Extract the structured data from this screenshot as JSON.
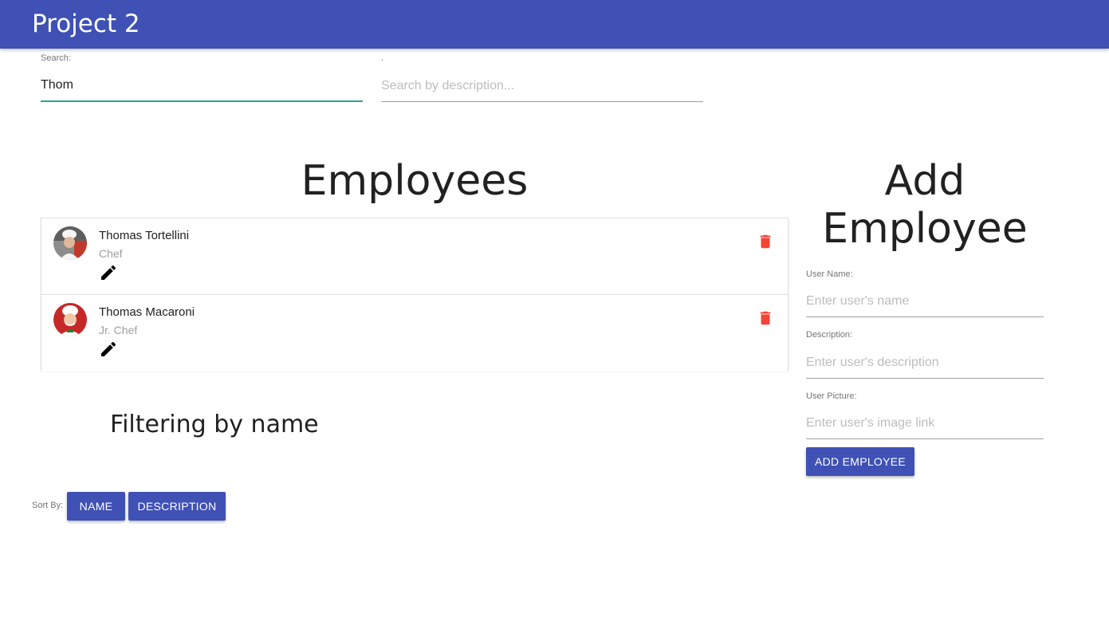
{
  "app": {
    "title": "Project 2",
    "accent_color": "#3f51b5",
    "focus_color": "#26a69a"
  },
  "search": {
    "name_label": "Search:",
    "name_value": "Thom",
    "desc_label": ".",
    "desc_placeholder": "Search by description..."
  },
  "employees": {
    "heading": "Employees",
    "items": [
      {
        "name": "Thomas Tortellini",
        "description": "Chef",
        "avatar": "chef-avatar",
        "edit_icon": "pencil-icon",
        "delete_icon": "trash-icon"
      },
      {
        "name": "Thomas Macaroni",
        "description": "Jr. Chef",
        "avatar": "chef-avatar",
        "edit_icon": "pencil-icon",
        "delete_icon": "trash-icon"
      }
    ]
  },
  "caption": "Filtering by name",
  "sort": {
    "label": "Sort By:",
    "name_button": "NAME",
    "description_button": "DESCRIPTION"
  },
  "add_employee": {
    "heading_line1": "Add",
    "heading_line2": "Employee",
    "user_name_label": "User Name:",
    "user_name_placeholder": "Enter user's name",
    "description_label": "Description:",
    "description_placeholder": "Enter user's description",
    "picture_label": "User Picture:",
    "picture_placeholder": "Enter user's image link",
    "submit_label": "ADD EMPLOYEE"
  }
}
